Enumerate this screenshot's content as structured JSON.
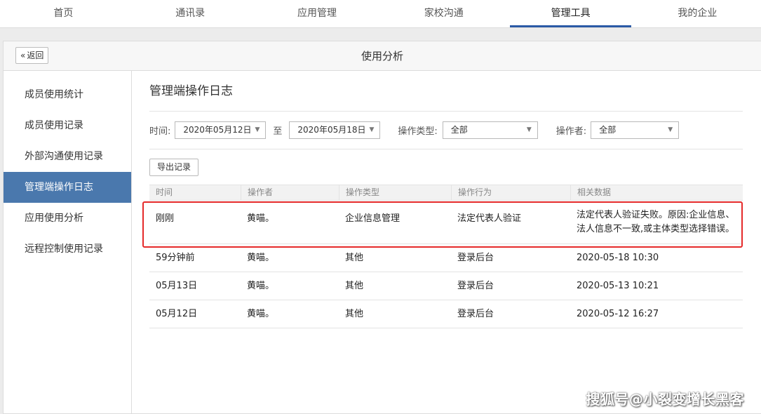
{
  "topnav": {
    "tabs": [
      {
        "label": "首页"
      },
      {
        "label": "通讯录"
      },
      {
        "label": "应用管理"
      },
      {
        "label": "家校沟通"
      },
      {
        "label": "管理工具"
      },
      {
        "label": "我的企业"
      }
    ],
    "active_index": 4,
    "accent_color": "#2b5aa6"
  },
  "header": {
    "back_label": "返回",
    "title": "使用分析"
  },
  "sidebar": {
    "items": [
      {
        "label": "成员使用统计"
      },
      {
        "label": "成员使用记录"
      },
      {
        "label": "外部沟通使用记录"
      },
      {
        "label": "管理端操作日志"
      },
      {
        "label": "应用使用分析"
      },
      {
        "label": "远程控制使用记录"
      }
    ],
    "active_index": 3,
    "active_color": "#4a78ad"
  },
  "main": {
    "title": "管理端操作日志",
    "filters": {
      "time_label": "时间:",
      "start_date": "2020年05月12日",
      "to_label": "至",
      "end_date": "2020年05月18日",
      "type_label": "操作类型:",
      "type_value": "全部",
      "operator_label": "操作者:",
      "operator_value": "全部"
    },
    "export_label": "导出记录",
    "table": {
      "headers": [
        "时间",
        "操作者",
        "操作类型",
        "操作行为",
        "相关数据"
      ],
      "rows": [
        {
          "time": "刚刚",
          "operator": "黄喵。",
          "type": "企业信息管理",
          "action": "法定代表人验证",
          "data_line1": "法定代表人验证失败。原因:企业信息、",
          "data_line2": "法人信息不一致,或主体类型选择错误。"
        },
        {
          "time": "59分钟前",
          "operator": "黄喵。",
          "type": "其他",
          "action": "登录后台",
          "data": "2020-05-18 10:30"
        },
        {
          "time": "05月13日",
          "operator": "黄喵。",
          "type": "其他",
          "action": "登录后台",
          "data": "2020-05-13 10:21"
        },
        {
          "time": "05月12日",
          "operator": "黄喵。",
          "type": "其他",
          "action": "登录后台",
          "data": "2020-05-12 16:27"
        }
      ]
    },
    "highlight_color": "#e52a2a"
  },
  "watermark": "搜狐号@小裂变增长黑客"
}
